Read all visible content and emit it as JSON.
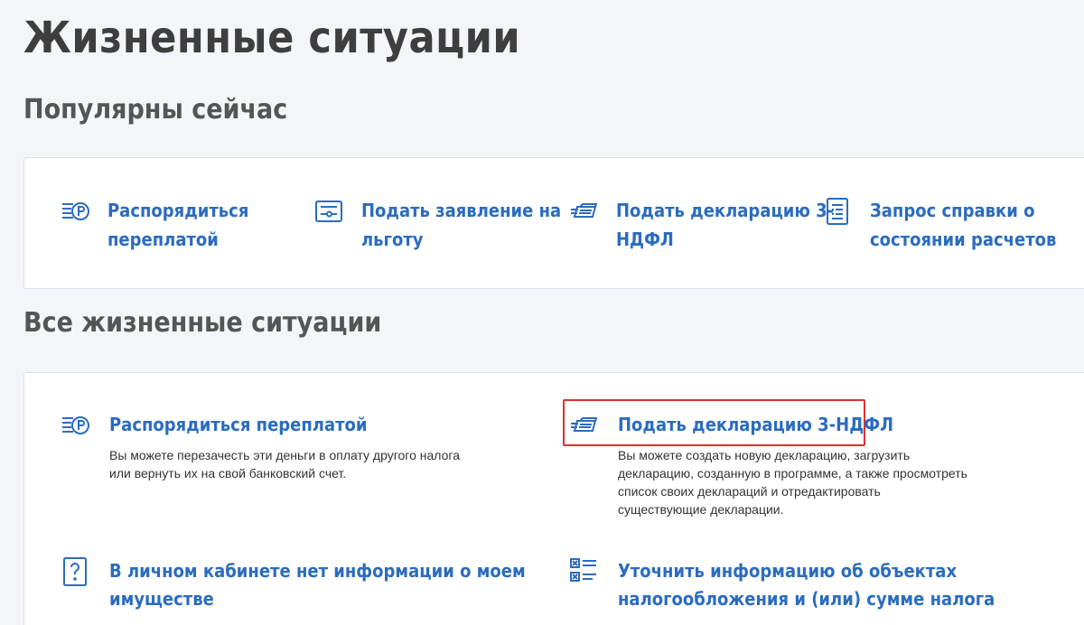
{
  "page": {
    "title": "Жизненные ситуации"
  },
  "popular": {
    "heading": "Популярны сейчас",
    "items": [
      {
        "label_l1": "Распорядиться",
        "label_l2": "переплатой",
        "icon": "overpayment-icon"
      },
      {
        "label_l1": "Подать заявление на",
        "label_l2": "льготу",
        "icon": "application-icon"
      },
      {
        "label_l1": "Подать декларацию 3-",
        "label_l2": "НДФЛ",
        "icon": "declaration-icon"
      },
      {
        "label_l1": "Запрос справки о",
        "label_l2": "состоянии расчетов",
        "icon": "certificate-icon"
      }
    ]
  },
  "all": {
    "heading": "Все жизненные ситуации",
    "items": [
      {
        "label": "Распорядиться переплатой",
        "desc_l1": "Вы можете перезачесть эти деньги в оплату другого налога",
        "desc_l2": "или вернуть их на свой банковский счет.",
        "icon": "overpayment-icon"
      },
      {
        "label": "Подать декларацию 3-НДФЛ",
        "desc_l1": "Вы можете создать новую декларацию, загрузить",
        "desc_l2": "декларацию, созданную в программе, а также просмотреть",
        "desc_l3": "список своих деклараций и отредактировать",
        "desc_l4": "существующие декларации.",
        "icon": "declaration-icon"
      },
      {
        "label_l1": "В личном кабинете нет информации о моем",
        "label_l2": "имуществе",
        "icon": "question-icon"
      },
      {
        "label_l1": "Уточнить информацию об объектах",
        "label_l2": "налогообложения и (или) сумме налога",
        "icon": "checklist-icon"
      }
    ]
  },
  "colors": {
    "link": "#2b6cbf",
    "highlight": "#e0312c",
    "background": "#f3f5f8"
  }
}
